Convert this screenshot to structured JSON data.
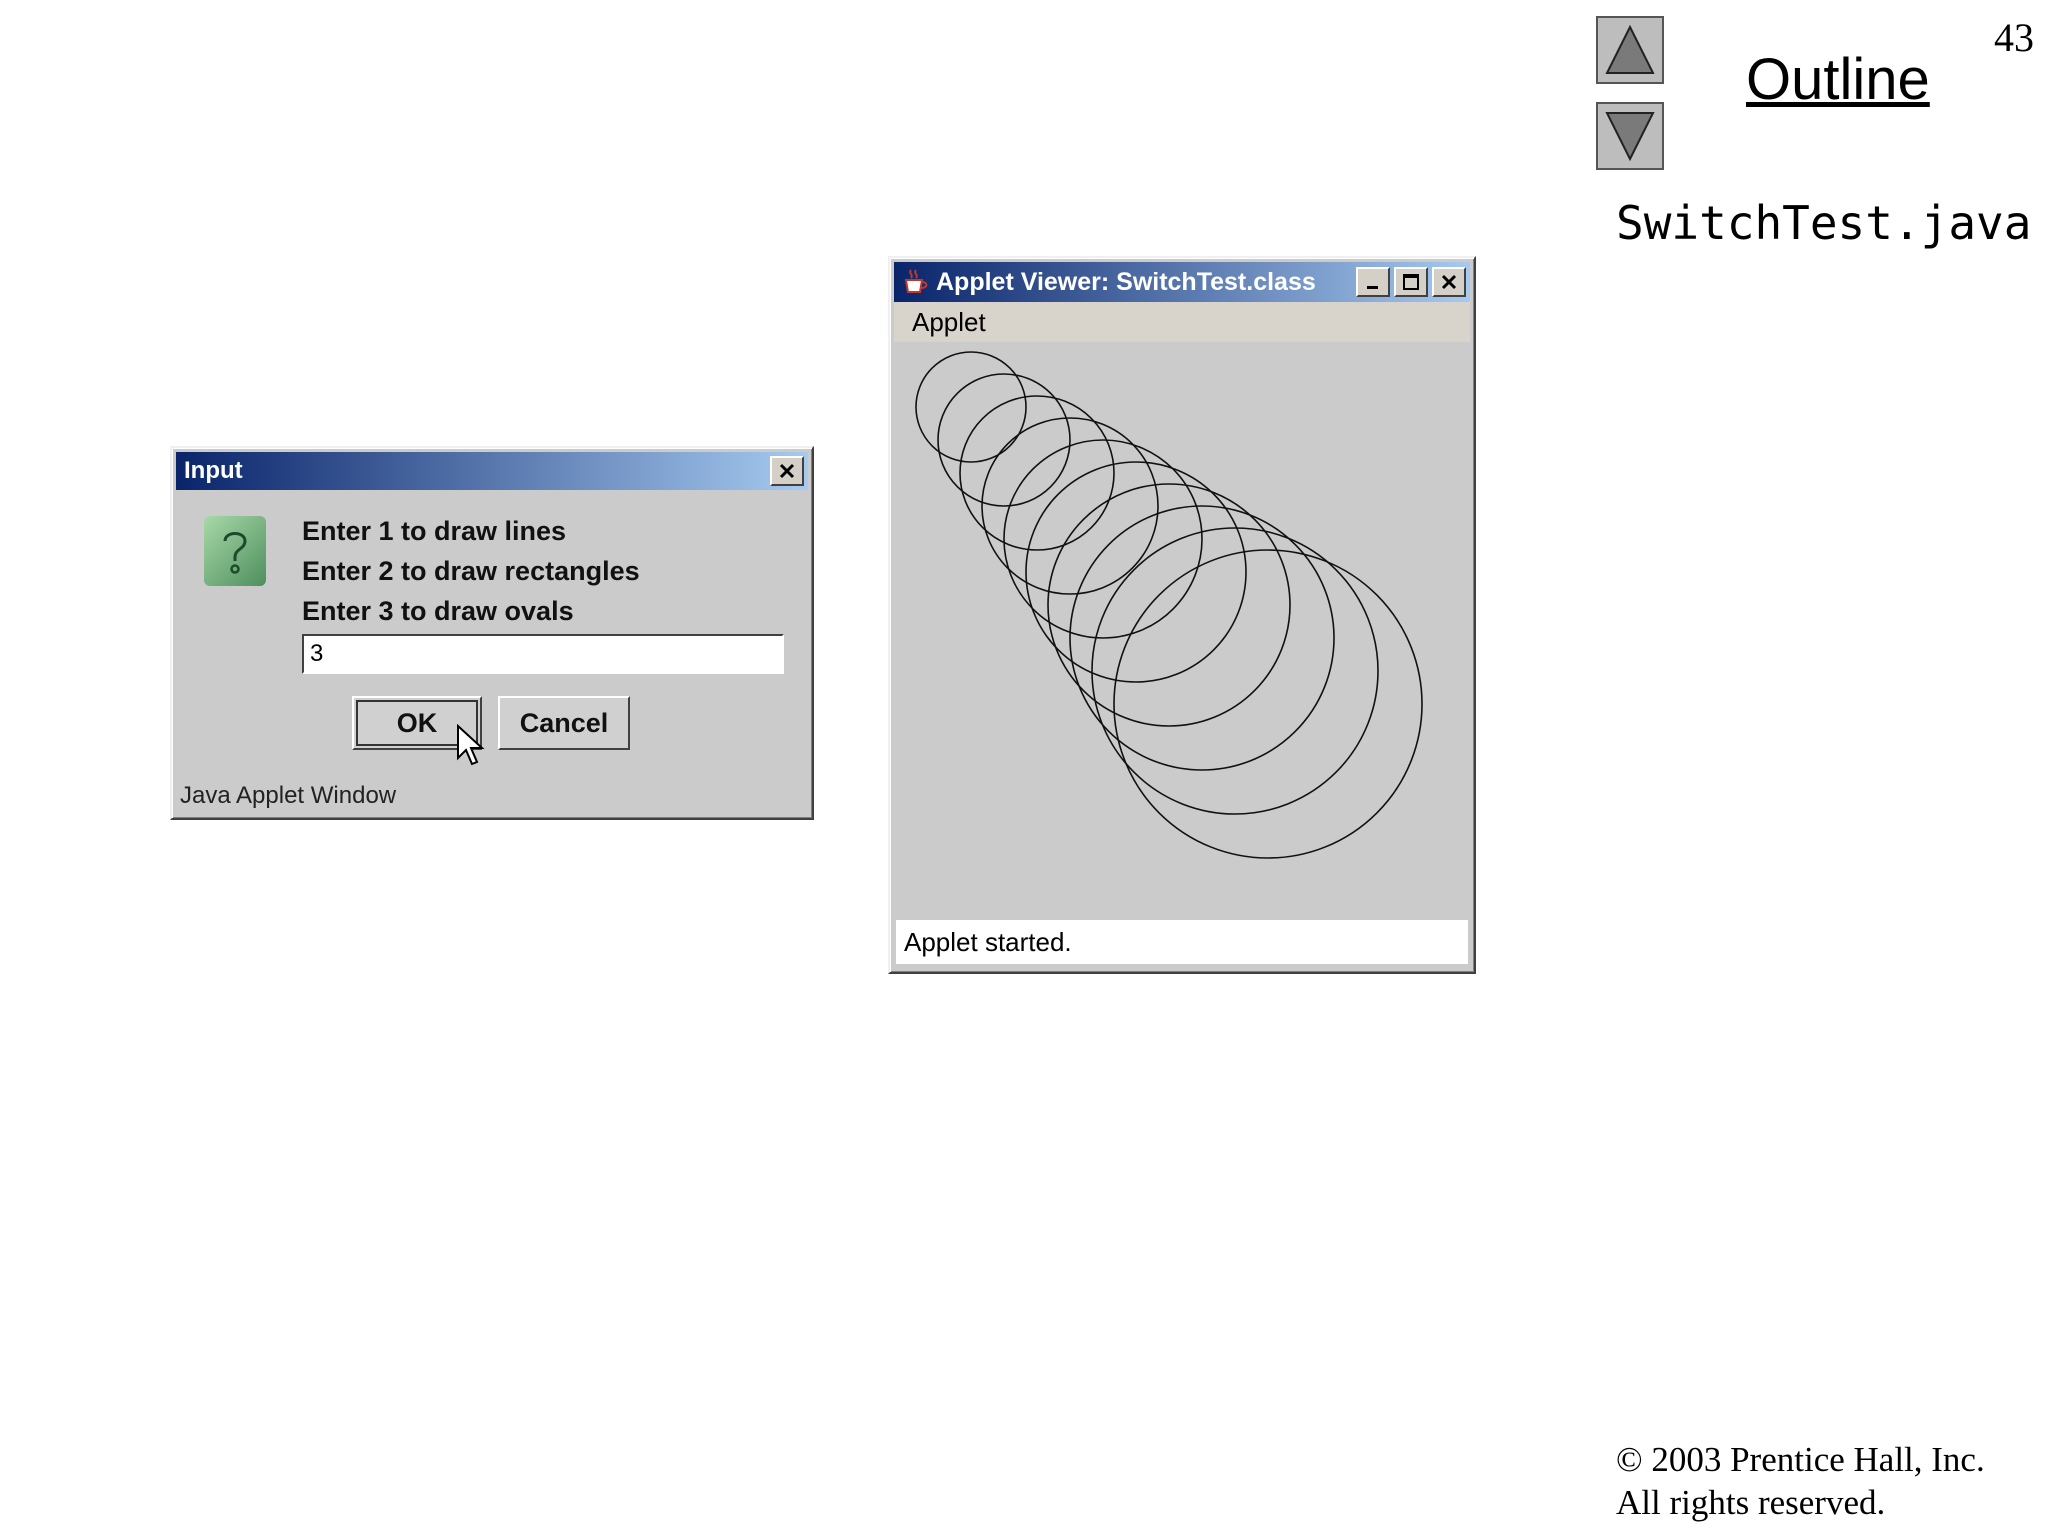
{
  "slide": {
    "page_number": "43",
    "outline_label": "Outline",
    "file_name": "SwitchTest.java",
    "copyright_line1": "© 2003 Prentice Hall, Inc.",
    "copyright_line2": "All rights reserved."
  },
  "input_dialog": {
    "title": "Input",
    "prompt_lines": [
      "Enter 1 to draw lines",
      "Enter 2 to draw rectangles",
      "Enter 3 to draw ovals"
    ],
    "input_value": "3",
    "ok_label": "OK",
    "cancel_label": "Cancel",
    "footer": "Java Applet Window"
  },
  "applet_viewer": {
    "title": "Applet Viewer: SwitchTest.class",
    "menu_label": "Applet",
    "status": "Applet started.",
    "oval_count": 10
  }
}
